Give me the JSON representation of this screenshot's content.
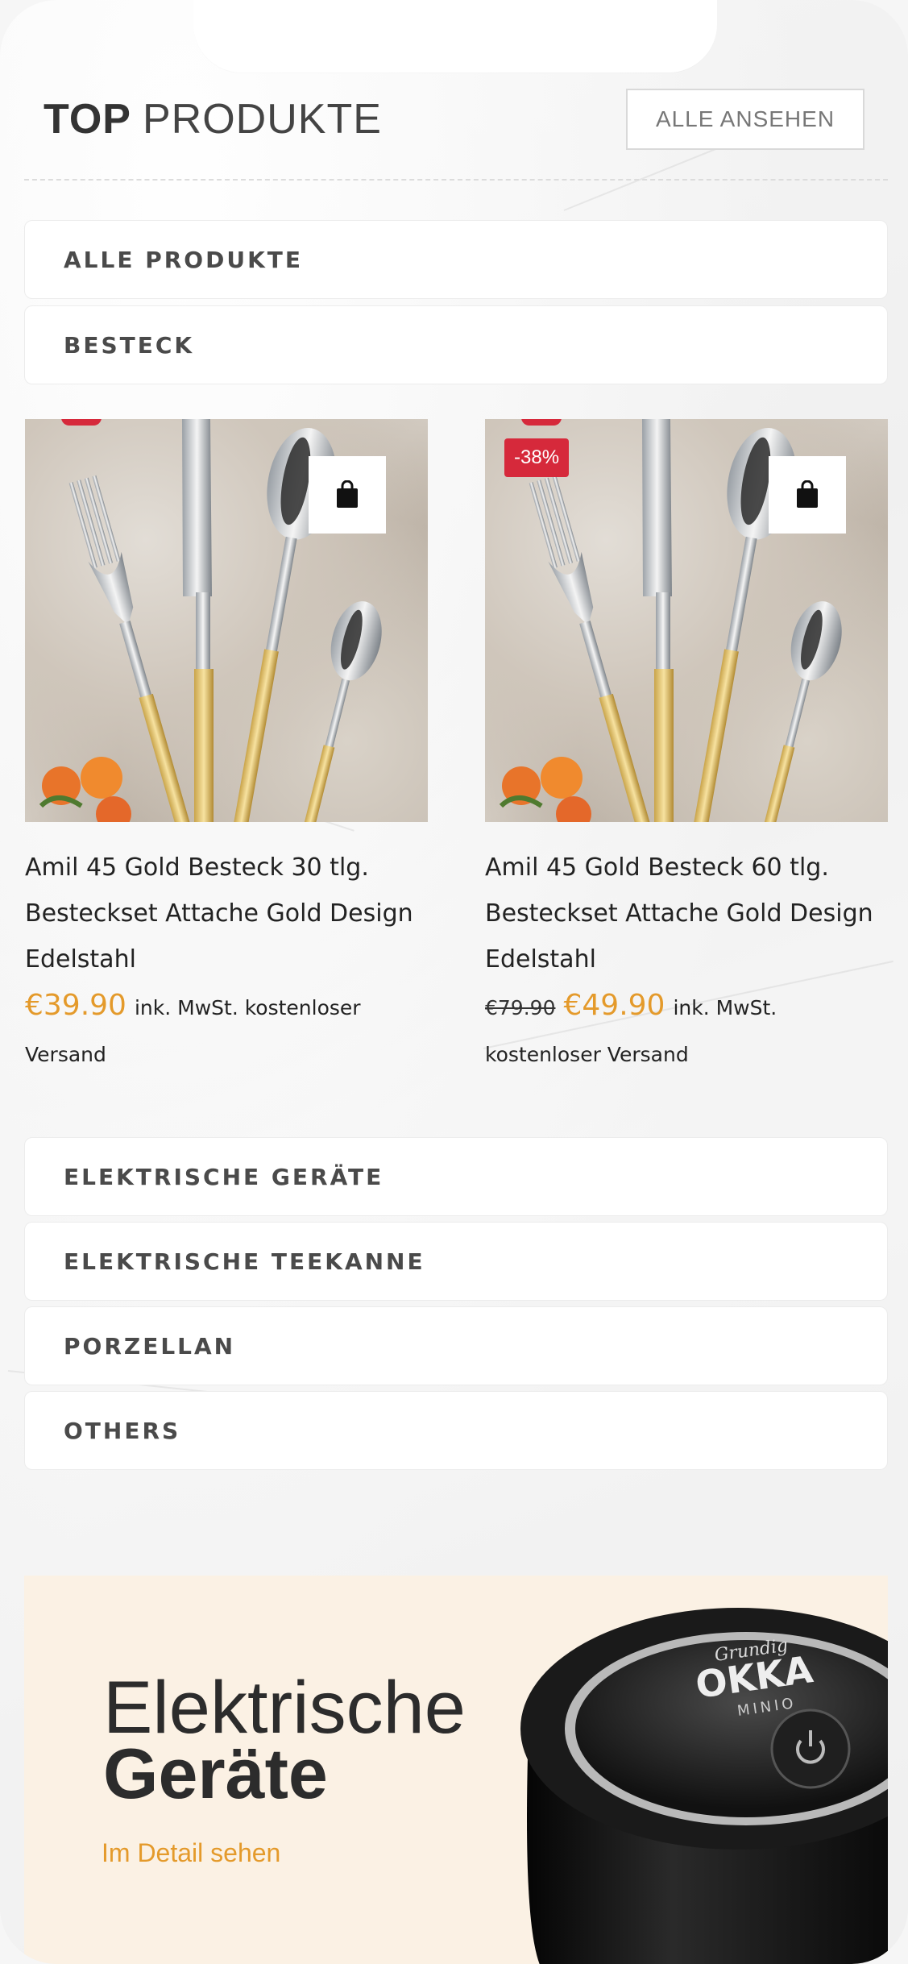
{
  "header": {
    "title_bold": "TOP",
    "title_light": "PRODUKTE",
    "see_all": "ALLE ANSEHEN"
  },
  "categories_top": [
    "ALLE PRODUKTE",
    "BESTECK"
  ],
  "products": [
    {
      "name": "Amil 45 Gold Besteck 30 tlg. Besteckset Attache Gold Design Edelstahl",
      "badge": "",
      "old_price": "",
      "price": "€39.90",
      "tax_note": "ink. MwSt. kostenloser Versand"
    },
    {
      "name": "Amil 45 Gold Besteck 60 tlg. Besteckset Attache Gold Design Edelstahl",
      "badge": "-38%",
      "old_price": "€79.90",
      "price": "€49.90",
      "tax_note": "ink. MwSt. kostenloser Versand"
    }
  ],
  "categories_bottom": [
    "ELEKTRISCHE GERÄTE",
    "ELEKTRISCHE TEEKANNE",
    "PORZELLAN",
    "OTHERS"
  ],
  "banner": {
    "line1": "Elektrische",
    "line2": "Geräte",
    "link": "Im Detail sehen",
    "brand_top": "Grundig",
    "brand_main": "OKKA",
    "brand_sub": "MINIO"
  },
  "colors": {
    "accent_price": "#e49a2b",
    "badge_red": "#d6293b",
    "banner_bg": "#fbf1e4"
  }
}
